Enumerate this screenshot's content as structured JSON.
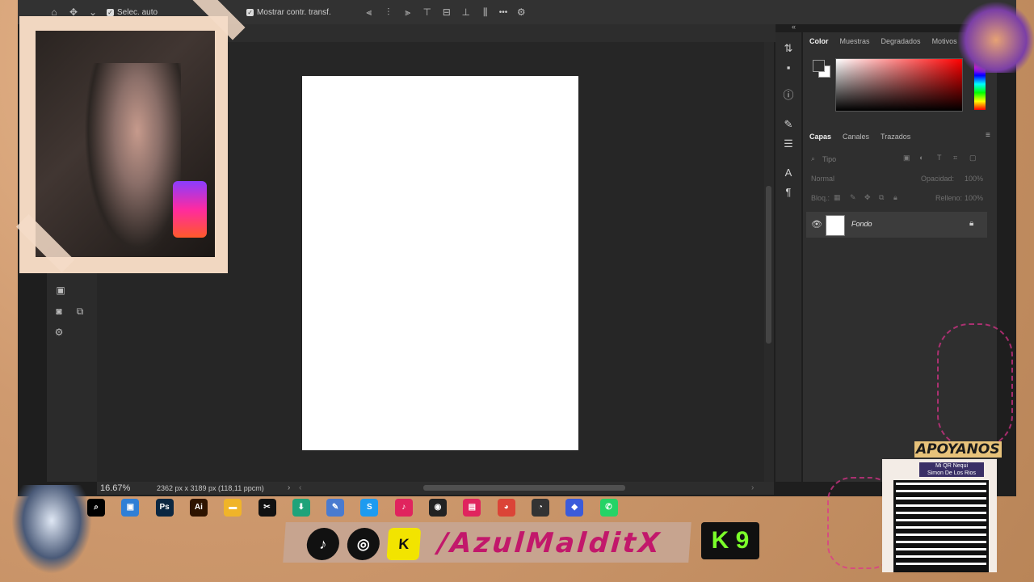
{
  "options_bar": {
    "select_auto_label": "Selec. auto",
    "show_transform_label": "Mostrar contr. transf.",
    "more_label": "•••"
  },
  "color_panel": {
    "tabs": [
      "Color",
      "Muestras",
      "Degradados",
      "Motivos"
    ],
    "active_tab": "Color"
  },
  "layers_panel": {
    "tabs": [
      "Capas",
      "Canales",
      "Trazados"
    ],
    "active_tab": "Capas",
    "search_placeholder": "Tipo",
    "blend_mode": "Normal",
    "opacity_label": "Opacidad:",
    "opacity_value": "100%",
    "lock_label": "Bloq.:",
    "fill_label": "Relleno:",
    "fill_value": "100%",
    "layers": [
      {
        "name": "Fondo",
        "visible": true,
        "locked": true
      }
    ]
  },
  "status_bar": {
    "zoom": "16.67%",
    "doc_info": "2362 px x 3189 px (118,11 ppcm)"
  },
  "taskbar": {
    "apps": [
      {
        "name": "search",
        "glyph": "⌕",
        "color": "#000000"
      },
      {
        "name": "file-explorer-gallery",
        "glyph": "▣",
        "color": "#2f7fd6"
      },
      {
        "name": "photoshop",
        "glyph": "Ps",
        "color": "#0b2741"
      },
      {
        "name": "illustrator",
        "glyph": "Ai",
        "color": "#2e1400"
      },
      {
        "name": "folder",
        "glyph": "▬",
        "color": "#f0b429"
      },
      {
        "name": "capcut",
        "glyph": "✂",
        "color": "#111111"
      },
      {
        "name": "installer",
        "glyph": "⬇",
        "color": "#1fa37a"
      },
      {
        "name": "paint",
        "glyph": "✎",
        "color": "#4a7bd0"
      },
      {
        "name": "skype",
        "glyph": "S",
        "color": "#1d9bf0"
      },
      {
        "name": "tiktok",
        "glyph": "♪",
        "color": "#e0245e"
      },
      {
        "name": "obs",
        "glyph": "◉",
        "color": "#222222"
      },
      {
        "name": "streamlabs",
        "glyph": "▤",
        "color": "#e0245e"
      },
      {
        "name": "chrome",
        "glyph": "◕",
        "color": "#db4437"
      },
      {
        "name": "obs-recording",
        "glyph": "◔",
        "color": "#333333"
      },
      {
        "name": "app-diamond",
        "glyph": "◆",
        "color": "#3b5bdb"
      },
      {
        "name": "whatsapp",
        "glyph": "✆",
        "color": "#25d366"
      }
    ]
  },
  "overlay": {
    "social_handle": "/AzulMalditX",
    "k9_label": "K 9",
    "apoyanos_label": "APOYANOS",
    "qr_caption_line1": "Mi QR Nequi",
    "qr_caption_line2": "Simon De Los Rios"
  }
}
